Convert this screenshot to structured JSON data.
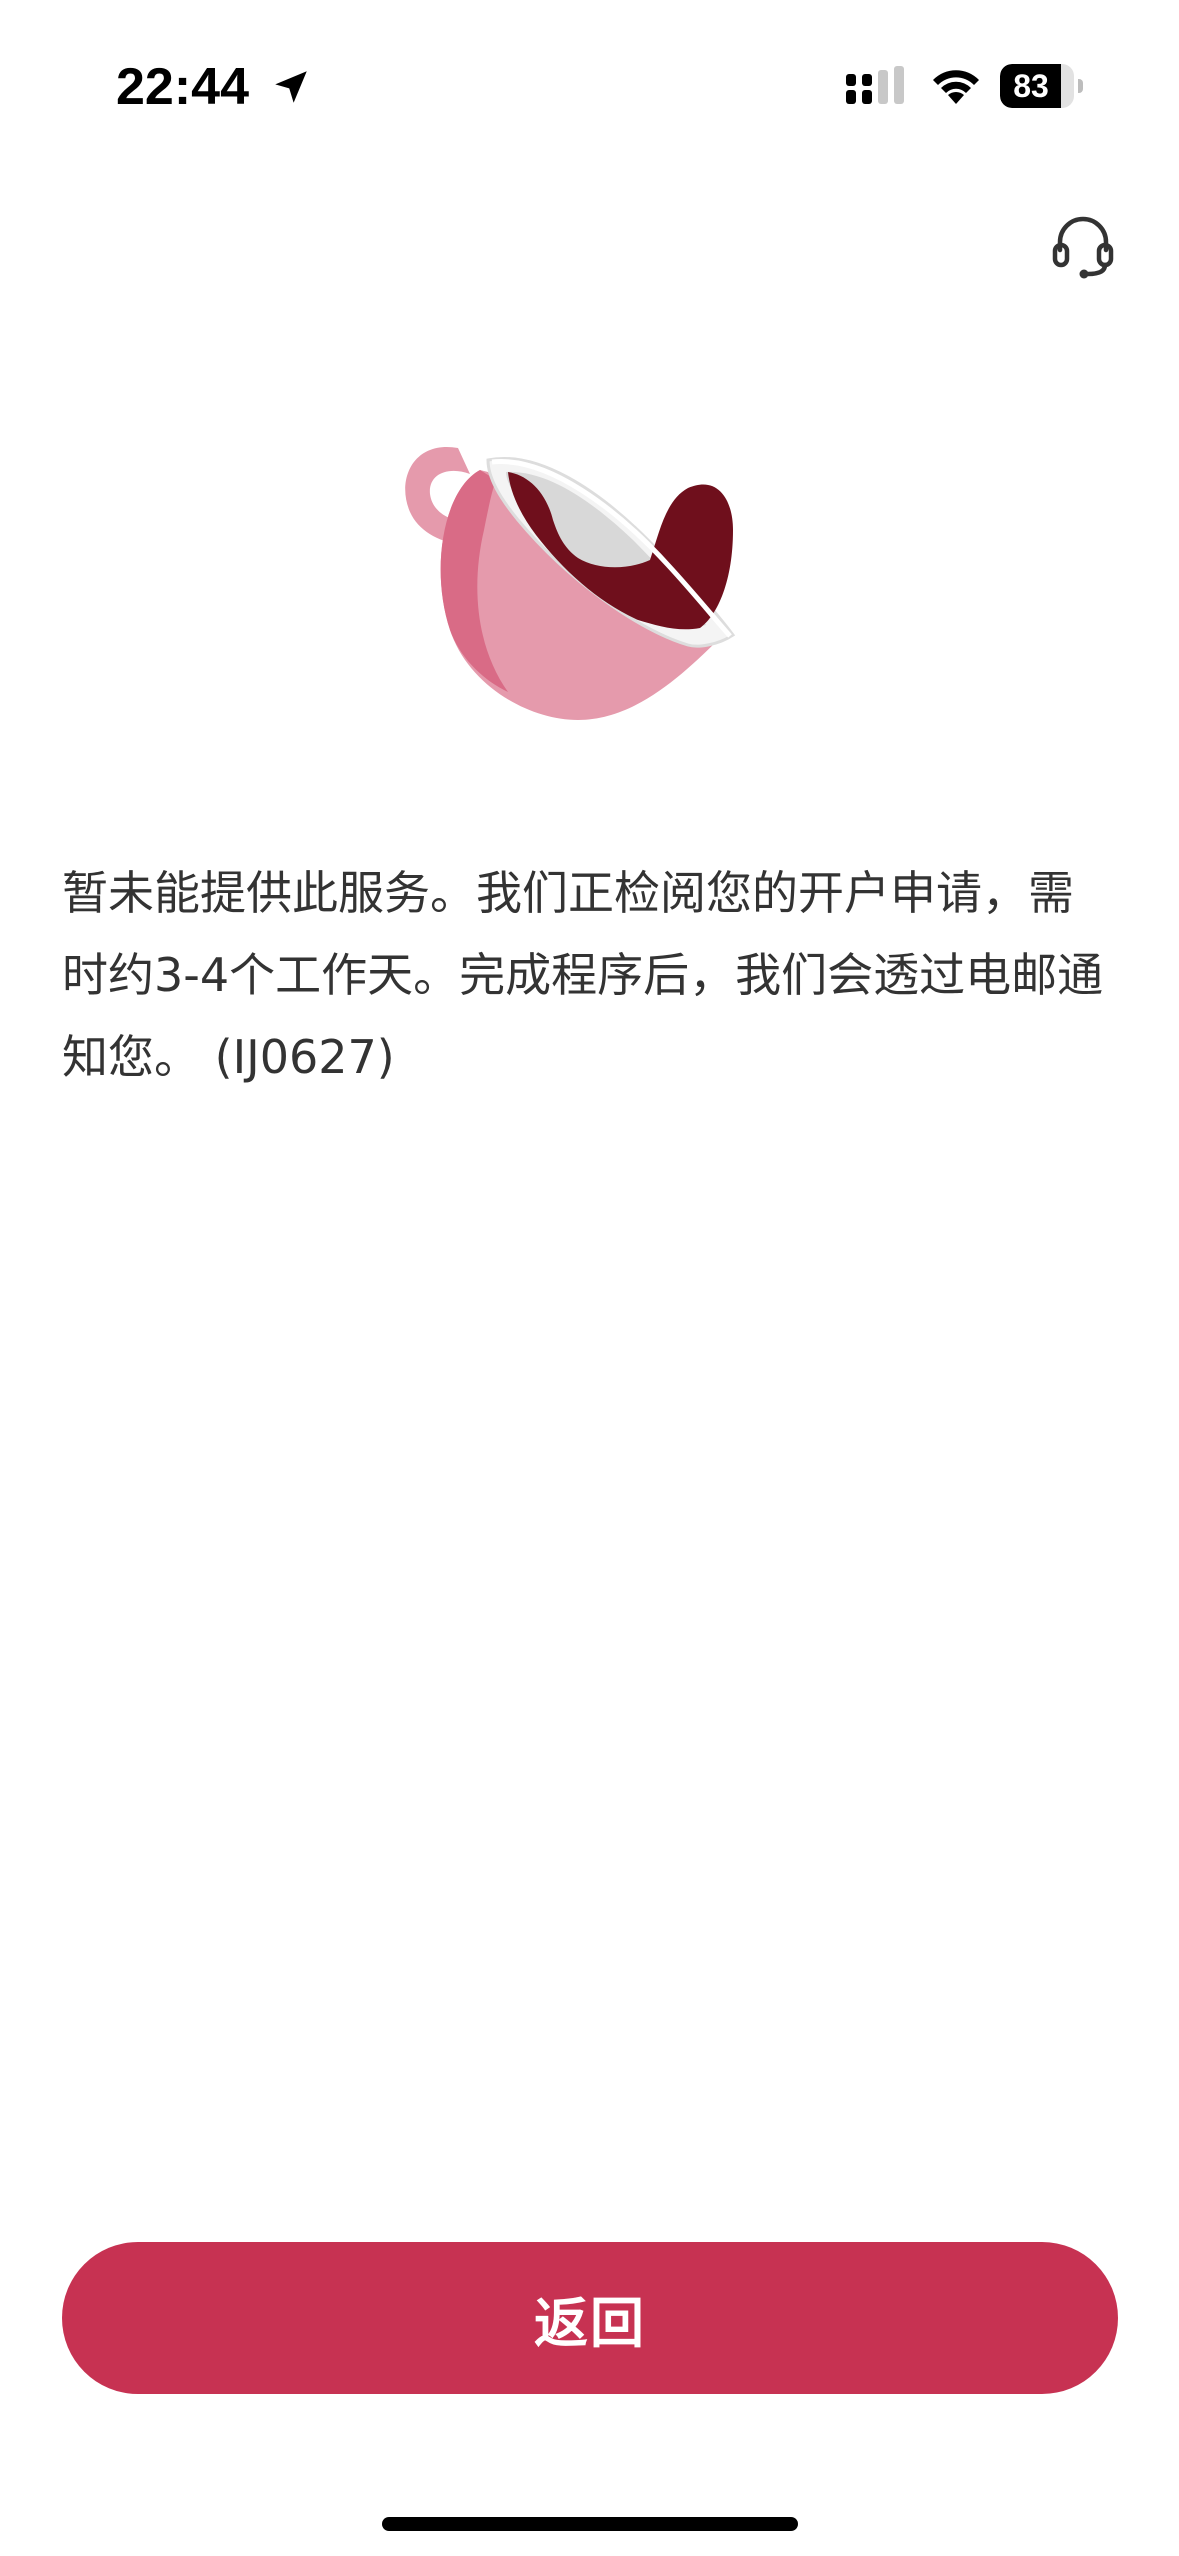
{
  "status_bar": {
    "time": "22:44",
    "battery_percent": "83",
    "battery_level": 0.83,
    "icons": [
      "location-arrow-icon",
      "cellular-signal-icon",
      "wifi-icon",
      "battery-icon"
    ]
  },
  "header": {
    "support_icon": "headset-icon"
  },
  "illustration": {
    "name": "coffee-cup-illustration"
  },
  "message": {
    "text": "暂未能提供此服务。我们正检阅您的开户申请，需时约3-4个工作天。完成程序后，我们会透过电邮通知您。 (IJ0627)"
  },
  "actions": {
    "back_label": "返回"
  },
  "colors": {
    "accent": "#c73252",
    "cup_pink": "#e59aac",
    "cup_dark_pink": "#d96b86",
    "coffee": "#6f0f1c",
    "text": "#333333"
  }
}
